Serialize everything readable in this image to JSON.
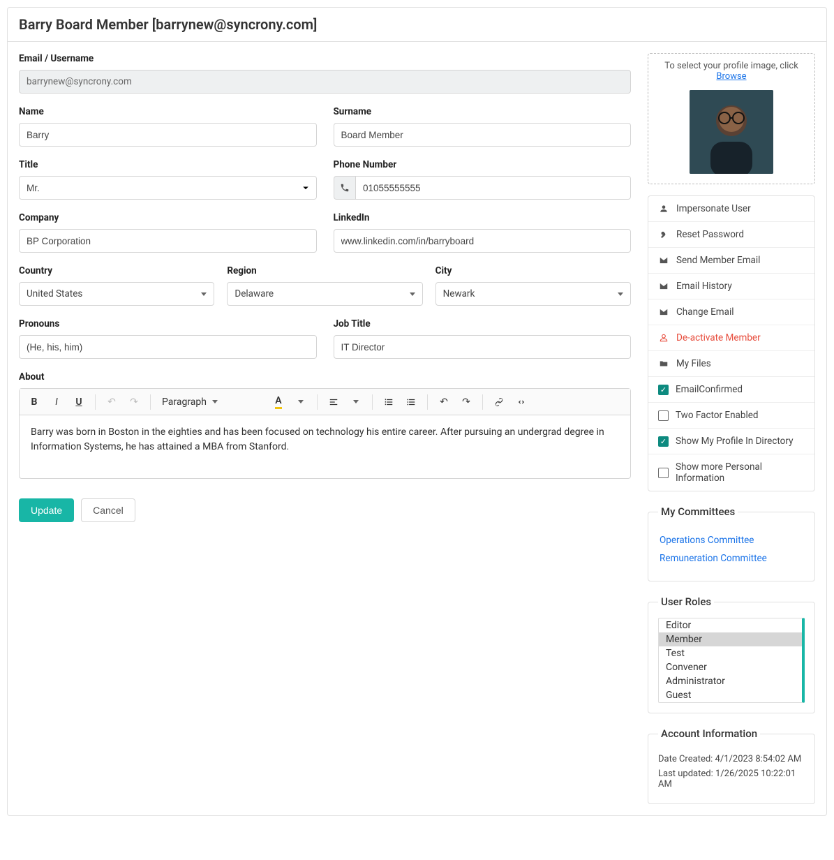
{
  "header": {
    "title": "Barry Board Member [barrynew@syncrony.com]"
  },
  "form": {
    "email_label": "Email / Username",
    "email_value": "barrynew@syncrony.com",
    "name_label": "Name",
    "name_value": "Barry",
    "surname_label": "Surname",
    "surname_value": "Board Member",
    "title_label": "Title",
    "title_value": "Mr.",
    "phone_label": "Phone Number",
    "phone_value": "01055555555",
    "company_label": "Company",
    "company_value": "BP Corporation",
    "linkedin_label": "LinkedIn",
    "linkedin_value": "www.linkedin.com/in/barryboard",
    "country_label": "Country",
    "country_value": "United States",
    "region_label": "Region",
    "region_value": "Delaware",
    "city_label": "City",
    "city_value": "Newark",
    "pronouns_label": "Pronouns",
    "pronouns_value": "(He, his, him)",
    "jobtitle_label": "Job Title",
    "jobtitle_value": "IT Director",
    "about_label": "About",
    "about_text": "Barry was born in Boston in the eighties and has been focused on technology his entire career. After pursuing an undergrad degree in Information Systems, he has attained a MBA from Stanford."
  },
  "editor_toolbar": {
    "paragraph_label": "Paragraph"
  },
  "sidebar": {
    "upload_prefix": "To select your profile image, click ",
    "upload_link": "Browse",
    "actions": [
      {
        "icon": "user-impersonate",
        "label": "Impersonate User"
      },
      {
        "icon": "key",
        "label": "Reset Password"
      },
      {
        "icon": "mail",
        "label": "Send Member Email"
      },
      {
        "icon": "mail",
        "label": "Email History"
      },
      {
        "icon": "mail",
        "label": "Change Email"
      },
      {
        "icon": "user-off",
        "label": "De-activate Member",
        "danger": true
      },
      {
        "icon": "folder",
        "label": "My Files"
      }
    ],
    "checks": [
      {
        "label": "EmailConfirmed",
        "on": true
      },
      {
        "label": "Two Factor Enabled",
        "on": false
      },
      {
        "label": "Show My Profile In Directory",
        "on": true
      },
      {
        "label": "Show more Personal Information",
        "on": false
      }
    ],
    "committees_title": "My Committees",
    "committees": [
      "Operations Committee",
      "Remuneration Committee"
    ],
    "roles_title": "User Roles",
    "roles": [
      "Editor",
      "Member",
      "Test",
      "Convener",
      "Administrator",
      "Guest"
    ],
    "roles_selected": "Member",
    "acct_title": "Account Information",
    "acct_created_label": "Date Created: ",
    "acct_created_value": "4/1/2023 8:54:02 AM",
    "acct_updated_label": "Last updated: ",
    "acct_updated_value": "1/26/2025 10:22:01 AM"
  },
  "buttons": {
    "update": "Update",
    "cancel": "Cancel"
  }
}
